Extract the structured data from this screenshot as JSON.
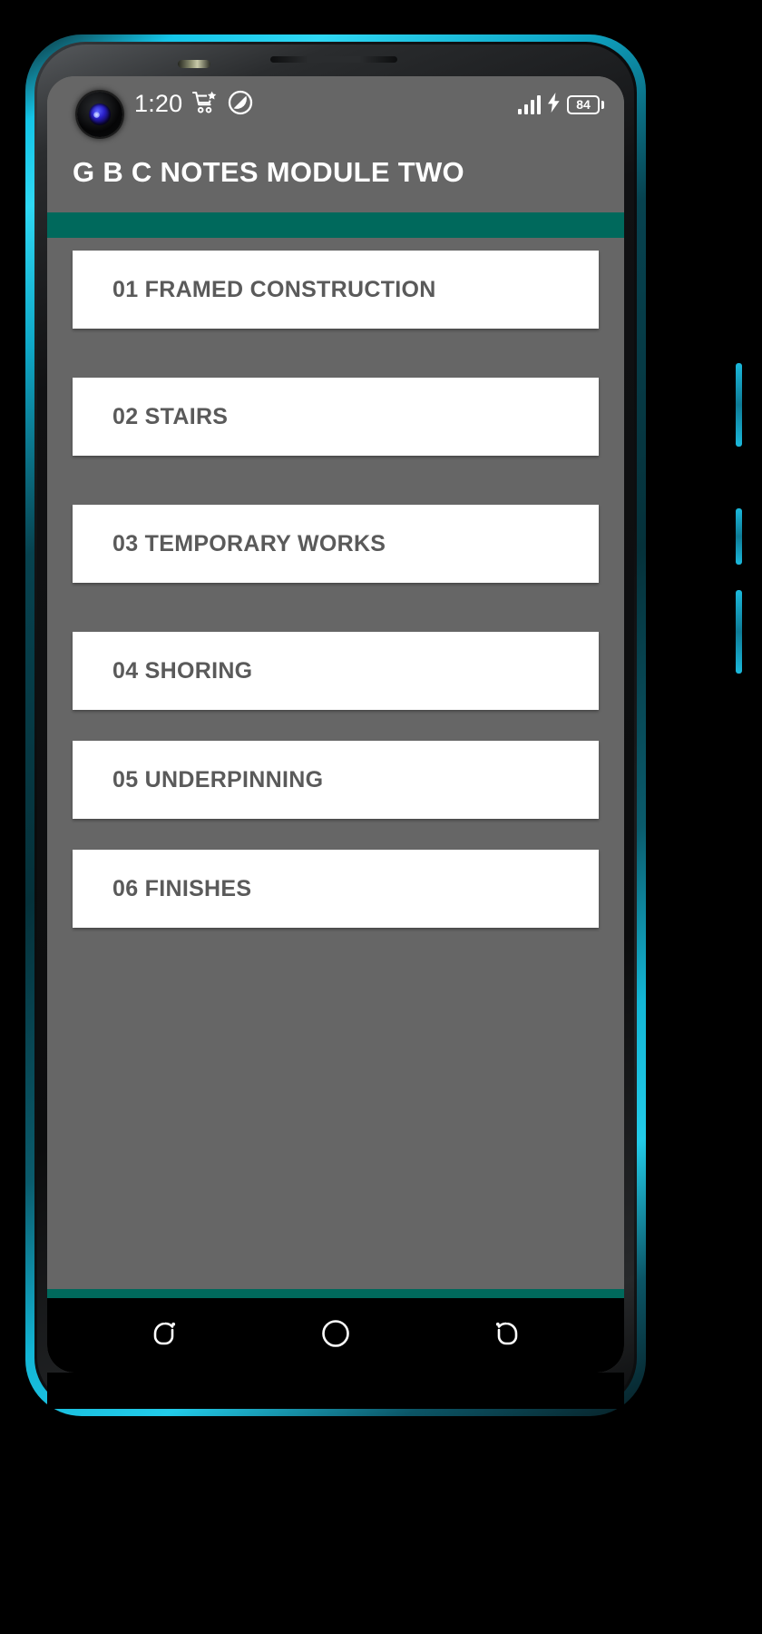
{
  "status_bar": {
    "clock": "1:20",
    "icons": [
      "camera-punch-hole",
      "cart-star-icon",
      "circle-slash-icon",
      "signal-bars-icon",
      "charging-bolt-icon",
      "battery-icon"
    ],
    "battery_level": "84"
  },
  "app_bar": {
    "title": "G B C NOTES MODULE TWO"
  },
  "colors": {
    "accent": "#00695c",
    "app_background": "#666666",
    "card_background": "#ffffff",
    "card_text": "#5a5a5a",
    "title_text": "#ffffff",
    "nav_background": "#000000",
    "frame_accent": "#22cbe9"
  },
  "list": {
    "items": [
      {
        "label": "01 FRAMED CONSTRUCTION"
      },
      {
        "label": "02 STAIRS"
      },
      {
        "label": "03 TEMPORARY WORKS"
      },
      {
        "label": "04 SHORING"
      },
      {
        "label": "05 UNDERPINNING"
      },
      {
        "label": "06 FINISHES"
      }
    ]
  },
  "nav_bar": {
    "buttons": [
      {
        "name": "recents-button",
        "icon": "rounded-square-loop-icon"
      },
      {
        "name": "home-button",
        "icon": "circle-icon"
      },
      {
        "name": "back-button",
        "icon": "back-loop-icon"
      }
    ]
  }
}
